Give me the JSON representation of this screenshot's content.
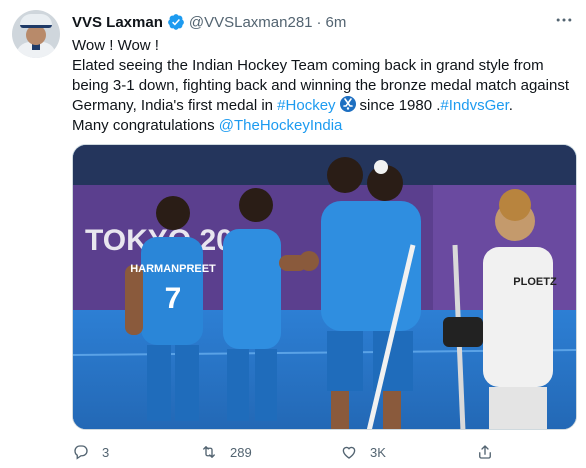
{
  "tweet": {
    "author_name": "VVS Laxman",
    "handle": "@VVSLaxman281",
    "separator": "·",
    "time": "6m",
    "lines": {
      "l1": "Wow ! Wow !",
      "l2": "Elated seeing the Indian Hockey Team coming back in grand style from",
      "l3": "being 3-1 down, fighting back and winning the bronze medal match against",
      "l4_pre": "Germany, India's first medal in",
      "l4_hashtag": "#Hockey",
      "l4_mid": "since 1980 .",
      "l4_hashtag2": "#IndvsGer",
      "l4_post": ".",
      "l5_pre": "Many congratulations",
      "l5_mention": "@TheHockeyIndia"
    },
    "media": {
      "banner_text": "TOKYO 2020",
      "jersey_name": "HARMANPREET",
      "jersey_number": "7",
      "opponent_name": "PLOETZ"
    },
    "actions": {
      "replies": "3",
      "retweets": "289",
      "likes": "3K"
    }
  },
  "colors": {
    "accent": "#1d9bf0",
    "secondary_text": "#536471",
    "primary_text": "#0f1419"
  },
  "icons": {
    "verified": "verified-badge-icon",
    "reply": "reply-icon",
    "retweet": "retweet-icon",
    "like": "heart-icon",
    "share": "share-icon",
    "hockey_emoji": "hockey-stick-emoji-icon"
  }
}
